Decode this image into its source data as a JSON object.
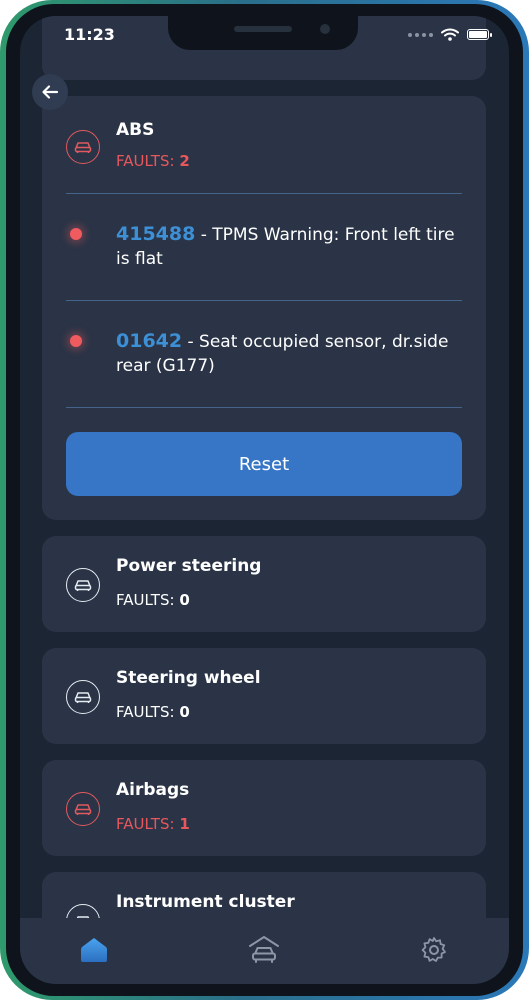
{
  "status_bar": {
    "time": "11:23"
  },
  "systems": [
    {
      "name": "ABS",
      "faults_label": "FAULTS:",
      "faults_count": "2",
      "fault_items": [
        {
          "code": "415488",
          "description": " - TPMS Warning: Front left tire is flat"
        },
        {
          "code": "01642",
          "description": " - Seat occupied sensor, dr.side rear (G177)"
        }
      ],
      "reset_label": "Reset"
    },
    {
      "name": "Power steering",
      "faults_label": "FAULTS:",
      "faults_count": "0"
    },
    {
      "name": "Steering wheel",
      "faults_label": "FAULTS:",
      "faults_count": "0"
    },
    {
      "name": "Airbags",
      "faults_label": "FAULTS:",
      "faults_count": "1"
    },
    {
      "name": "Instrument cluster"
    }
  ],
  "tab_bar": {
    "items": [
      "home-icon",
      "car-garage-icon",
      "gear-icon"
    ],
    "active_index": 0
  },
  "colors": {
    "accent": "#3776c7",
    "fault_red": "#e8575c",
    "card_bg": "#2a3446",
    "screen_bg": "#1c2533",
    "code_blue": "#3d8fd6"
  }
}
